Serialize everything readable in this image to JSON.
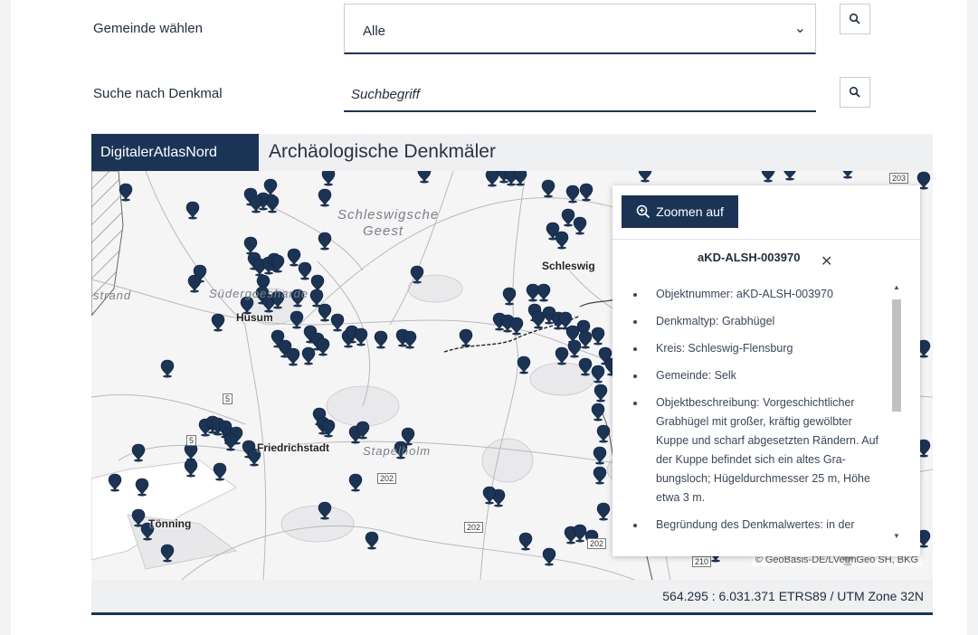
{
  "filters": {
    "municipality_label": "Gemeinde wählen",
    "municipality_value": "Alle",
    "search_label": "Suche nach Denkmal",
    "search_placeholder": "Suchbegriff"
  },
  "map": {
    "brand": "DigitalerAtlasNord",
    "title": "Archäologische Denkmäler",
    "places": [
      "Husum",
      "Friedrichstadt",
      "Tönning",
      "Schleswig"
    ],
    "regions": [
      "Schleswigsche",
      "Geest",
      "Südergoesharde",
      "Stapelholm",
      "strand"
    ],
    "roads": [
      "5",
      "5",
      "202",
      "202",
      "202",
      "203",
      "210"
    ],
    "attribution": "© GeoBasis-DE/LVermGeo SH, BKG",
    "coordinates": "564.295 : 6.031.371  ETRS89 / UTM Zone 32N",
    "marker_color": "#1b3456"
  },
  "popup": {
    "zoom_label": "Zoomen auf",
    "title": "aKD-ALSH-003970",
    "items": [
      "Objektnummer: aKD-ALSH-003970",
      "Denkmaltyp: Grabhügel",
      "Kreis: Schleswig-Flensburg",
      "Gemeinde: Selk",
      "Objektbeschreibung: Vorgeschichtlicher Grabhügel mit großer, kräftig gewölbter Kuppe und scharf abgesetzten Rändern. Auf der Kuppe befindet sich ein altes Gra-bungsloch; Hügeldurchmesser 25 m, Höhe etwa 3 m.",
      "Begründung des Denkmalwertes: in der"
    ]
  }
}
